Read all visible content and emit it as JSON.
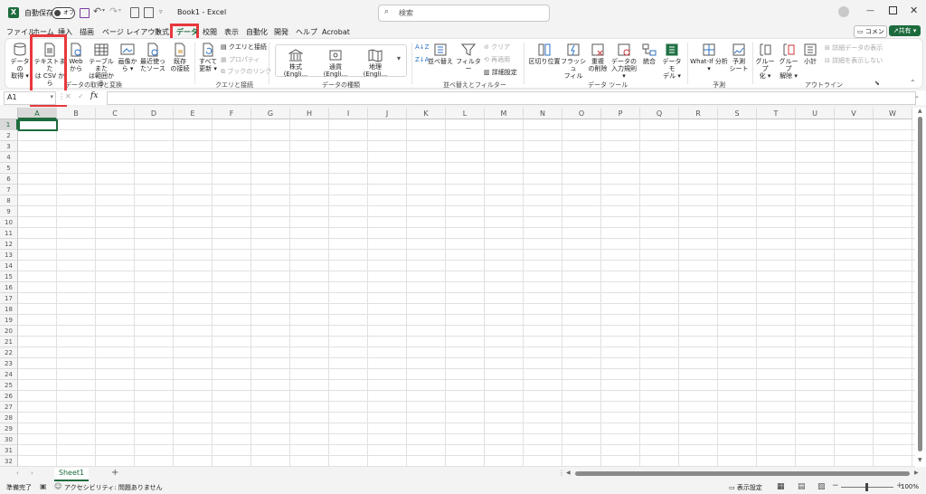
{
  "titlebar": {
    "autosave_label": "自動保存",
    "autosave_state": "オフ",
    "doc_title": "Book1 - Excel",
    "search_placeholder": "検索"
  },
  "menu": {
    "tabs": [
      "ファイル",
      "ホーム",
      "挿入",
      "描画",
      "ページ レイアウト",
      "数式",
      "データ",
      "校閲",
      "表示",
      "自動化",
      "開発",
      "ヘルプ",
      "Acrobat"
    ],
    "active_tab": "データ",
    "comment_label": "コメント",
    "share_label": "共有"
  },
  "ribbon": {
    "get_data": {
      "line1": "データの",
      "line2": "取得"
    },
    "text_csv": {
      "line1": "テキストまた",
      "line2": "は CSV から"
    },
    "web": {
      "line1": "Web",
      "line2": "から"
    },
    "table_range": {
      "line1": "テーブルまた",
      "line2": "は範囲から"
    },
    "image": {
      "line1": "画像か",
      "line2": "ら"
    },
    "recent": {
      "line1": "最近使っ",
      "line2": "たソース"
    },
    "existing": {
      "line1": "既存",
      "line2": "の接続"
    },
    "group_get": "データの取得と変換",
    "refresh_all": {
      "line1": "すべて",
      "line2": "更新"
    },
    "queries_conn": "クエリと接続",
    "properties": "プロパティ",
    "edit_links": "ブックのリンク",
    "group_queries": "クエリと接続",
    "stocks": "株式 (Engli...",
    "currency": "通貨 (Engli...",
    "geography": "地理 (Engli...",
    "group_types": "データの種類",
    "sort": "並べ替え",
    "filter": "フィルター",
    "clear": "クリア",
    "reapply": "再適用",
    "advanced": "詳細設定",
    "group_sort": "並べ替えとフィルター",
    "text_to_cols": "区切り位置",
    "flash_fill": {
      "line1": "フラッシュ",
      "line2": "フィル"
    },
    "remove_dup": {
      "line1": "重複",
      "line2": "の削除"
    },
    "validation": {
      "line1": "データの",
      "line2": "入力規則"
    },
    "consolidate": "統合",
    "data_model": {
      "line1": "データ モ",
      "line2": "デル"
    },
    "group_tools": "データ ツール",
    "whatif": "What-If 分析",
    "forecast": {
      "line1": "予測",
      "line2": "シート"
    },
    "group_forecast": "予測",
    "group_btn": {
      "line1": "グループ",
      "line2": "化"
    },
    "ungroup": {
      "line1": "グループ",
      "line2": "解除"
    },
    "subtotal": "小計",
    "show_detail": "詳細データの表示",
    "hide_detail": "詳細を表示しない",
    "group_outline": "アウトライン"
  },
  "formula": {
    "name_box": "A1",
    "fx": "fx",
    "value": ""
  },
  "grid": {
    "columns": [
      "A",
      "B",
      "C",
      "D",
      "E",
      "F",
      "G",
      "H",
      "I",
      "J",
      "K",
      "L",
      "M",
      "N",
      "O",
      "P",
      "Q",
      "R",
      "S",
      "T",
      "U",
      "V",
      "W"
    ],
    "rows": [
      "1",
      "2",
      "3",
      "4",
      "5",
      "6",
      "7",
      "8",
      "9",
      "10",
      "11",
      "12",
      "13",
      "14",
      "15",
      "16",
      "17",
      "18",
      "19",
      "20",
      "21",
      "22",
      "23",
      "24",
      "25",
      "26",
      "27",
      "28",
      "29",
      "30",
      "31",
      "32"
    ]
  },
  "sheets": {
    "tabs": [
      "Sheet1"
    ],
    "add": "+"
  },
  "status": {
    "ready": "準備完了",
    "accessibility": "アクセシビリティ: 問題ありません",
    "display_settings": "表示設定",
    "zoom": "100%"
  },
  "colors": {
    "excel_green": "#1d6b3d",
    "highlight": "#e8383d",
    "accent": "#217346"
  }
}
